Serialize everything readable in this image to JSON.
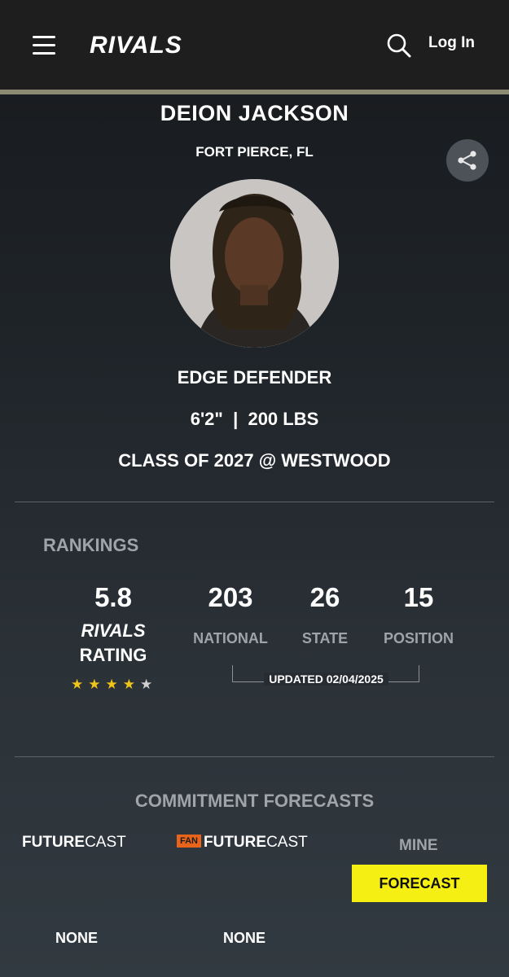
{
  "header": {
    "logo_text": "RIVALS",
    "login_label": "Log In",
    "icons": {
      "menu": "hamburger-menu-icon",
      "search": "search-icon"
    }
  },
  "profile": {
    "name": "DEION JACKSON",
    "hometown": "FORT PIERCE, FL",
    "position": "EDGE DEFENDER",
    "height_weight": "6'2\"  |  200 LBS",
    "class_school": "CLASS OF 2027 @ WESTWOOD",
    "share_icon": "share-icon"
  },
  "rankings": {
    "title": "RANKINGS",
    "rating": "5.8",
    "rating_logo": "RIVALS",
    "rating_label": "RATING",
    "stars": 4,
    "stars_total": 5,
    "national_value": "203",
    "national_label": "NATIONAL",
    "state_value": "26",
    "state_label": "STATE",
    "position_value": "15",
    "position_label": "POSITION",
    "updated": "UPDATED 02/04/2025"
  },
  "forecasts": {
    "title": "COMMITMENT FORECASTS",
    "futurecast_bold": "FUTURE",
    "futurecast_light": "CAST",
    "fan_tag": "FAN",
    "fan_futurecast_bold": "FUTURE",
    "fan_futurecast_light": "CAST",
    "mine_label": "MINE",
    "forecast_button": "FORECAST",
    "futurecast_value": "NONE",
    "fan_futurecast_value": "NONE"
  },
  "colors": {
    "accent_yellow": "#f5ef13",
    "star_gold": "#f0c419",
    "fan_orange": "#e8641a",
    "header_rule": "#8b8a72"
  }
}
